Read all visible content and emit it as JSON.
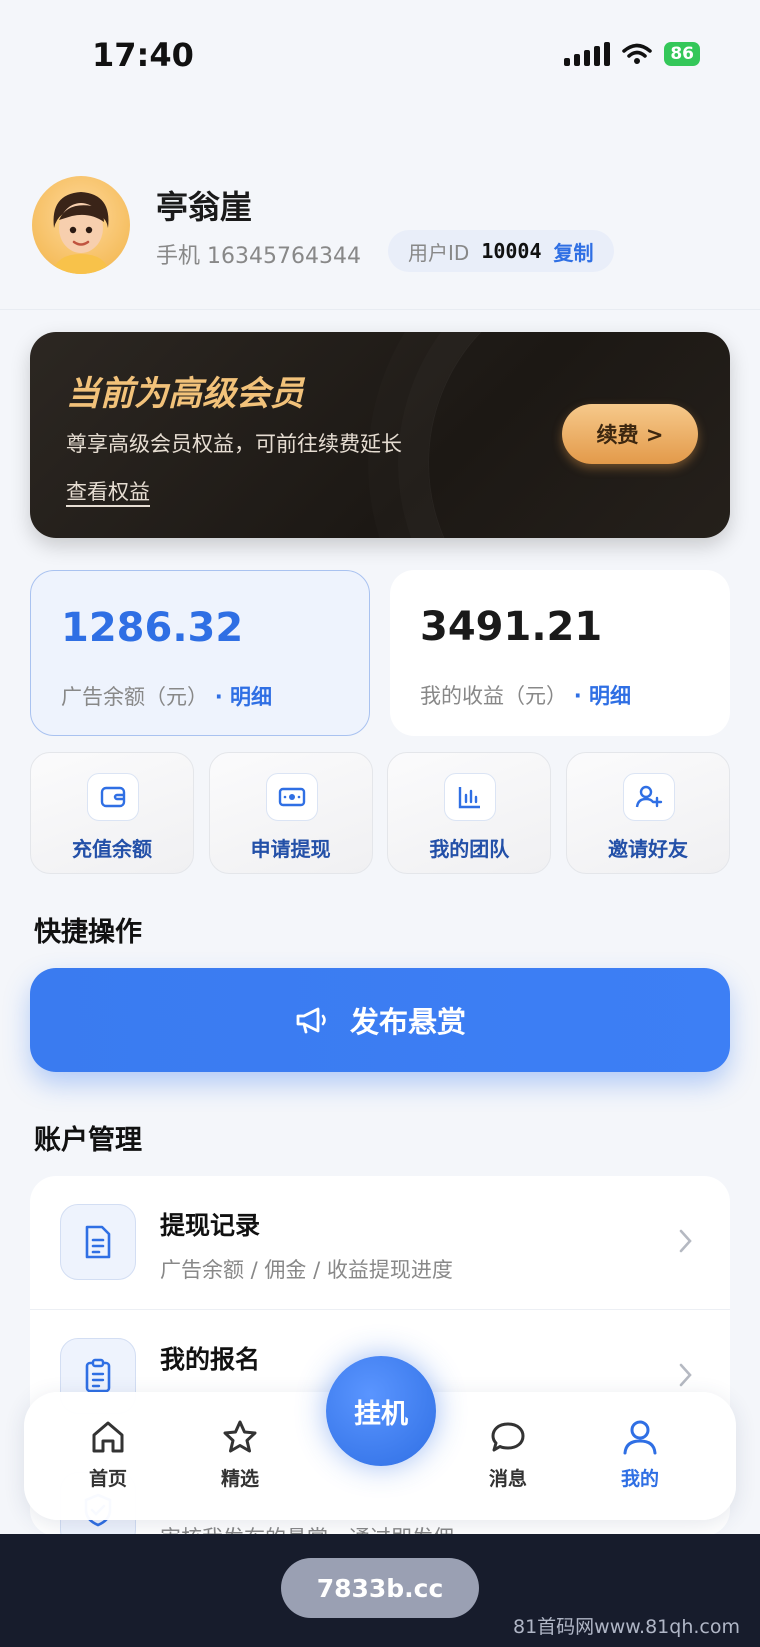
{
  "status_bar": {
    "time": "17:40",
    "battery": "86"
  },
  "profile": {
    "name": "亭翁崖",
    "phone": "手机 16345764344",
    "uid_label": "用户ID",
    "uid_value": "10004",
    "copy_label": "复制"
  },
  "vip": {
    "title": "当前为高级会员",
    "desc": "尊享高级会员权益，可前往续费延长",
    "link": "查看权益",
    "renew": "续费 >"
  },
  "balances": [
    {
      "value": "1286.32",
      "label": "广告余额（元）",
      "link": "· 明细"
    },
    {
      "value": "3491.21",
      "label": "我的收益（元）",
      "link": "· 明细"
    }
  ],
  "actions": [
    {
      "label": "充值余额",
      "icon": "wallet-icon"
    },
    {
      "label": "申请提现",
      "icon": "cash-icon"
    },
    {
      "label": "我的团队",
      "icon": "bar-chart-icon"
    },
    {
      "label": "邀请好友",
      "icon": "add-user-icon"
    }
  ],
  "quick_section": {
    "title": "快捷操作",
    "publish_label": "发布悬赏"
  },
  "account_section": {
    "title": "账户管理",
    "rows": [
      {
        "title": "提现记录",
        "sub": "广告余额 / 佣金 / 收益提现进度"
      },
      {
        "title": "我的报名",
        "sub": ""
      },
      {
        "title": "",
        "sub": "审核我发布的悬赏，通过即发佣"
      }
    ]
  },
  "tabbar": {
    "tabs": [
      {
        "label": "首页",
        "icon": "home-icon"
      },
      {
        "label": "精选",
        "icon": "star-icon"
      },
      {
        "label": "消息",
        "icon": "chat-icon"
      },
      {
        "label": "我的",
        "icon": "user-icon",
        "active": true
      }
    ],
    "fab_label": "挂机"
  },
  "footer": {
    "domain": "7833b.cc",
    "watermark": "81首码网www.81qh.com"
  },
  "colors": {
    "accent": "#2f6fe4",
    "gold": "#f2c27a",
    "dark_card": "#1c1814"
  }
}
